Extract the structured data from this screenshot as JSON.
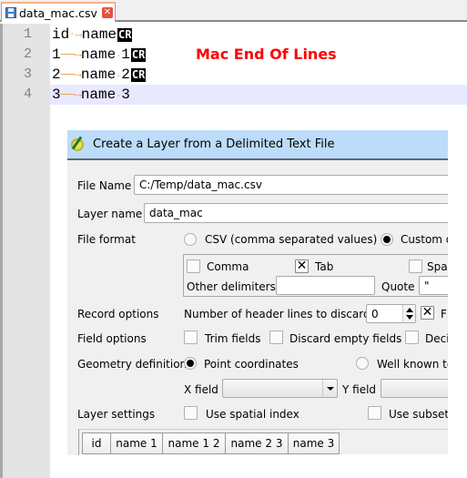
{
  "editor": {
    "tab": {
      "label": "data_mac.csv",
      "icon": "save-icon",
      "close_icon": "close-icon"
    },
    "annotation": "Mac End Of Lines",
    "lines": [
      {
        "num": "1",
        "parts": [
          "id",
          "name"
        ],
        "eol": "CR"
      },
      {
        "num": "2",
        "parts": [
          "1",
          "name 1"
        ],
        "eol": "CR"
      },
      {
        "num": "3",
        "parts": [
          "2",
          "name 2"
        ],
        "eol": "CR"
      },
      {
        "num": "4",
        "parts": [
          "3",
          "name 3"
        ],
        "eol": ""
      }
    ],
    "current_line": 4
  },
  "dialog": {
    "title": "Create a Layer from a Delimited Text File",
    "file_name": {
      "label": "File Name",
      "value": "C:/Temp/data_mac.csv"
    },
    "layer_name": {
      "label": "Layer name",
      "value": "data_mac"
    },
    "file_format": {
      "label": "File format",
      "options": [
        {
          "label": "CSV (comma separated values)",
          "selected": false
        },
        {
          "label": "Custom d",
          "selected": true
        }
      ]
    },
    "delimiters": {
      "comma": {
        "label": "Comma",
        "checked": false
      },
      "tab": {
        "label": "Tab",
        "checked": true
      },
      "space": {
        "label": "Spac",
        "checked": false
      },
      "other_label": "Other delimiters",
      "other_value": "",
      "quote_label": "Quote",
      "quote_value": "\""
    },
    "record_options": {
      "label": "Record options",
      "header_lines_label": "Number of header lines to discard",
      "header_lines_value": "0",
      "first_record_label": "F",
      "first_record_checked": true
    },
    "field_options": {
      "label": "Field options",
      "trim": {
        "label": "Trim fields",
        "checked": false
      },
      "discard_empty": {
        "label": "Discard empty fields",
        "checked": false
      },
      "decimal": {
        "label": "Deci",
        "checked": false
      }
    },
    "geometry": {
      "label": "Geometry definition",
      "point": {
        "label": "Point coordinates",
        "selected": true
      },
      "wkt": {
        "label": "Well known te",
        "selected": false
      },
      "x_field_label": "X field",
      "x_field_value": "",
      "y_field_label": "Y field",
      "y_field_value": ""
    },
    "layer_settings": {
      "label": "Layer settings",
      "spatial_index": {
        "label": "Use spatial index",
        "checked": false
      },
      "subset": {
        "label": "Use subset",
        "checked": false
      }
    },
    "preview_headers": [
      "id",
      "name 1",
      "name 1 2",
      "name 2 3",
      "name 3"
    ]
  }
}
